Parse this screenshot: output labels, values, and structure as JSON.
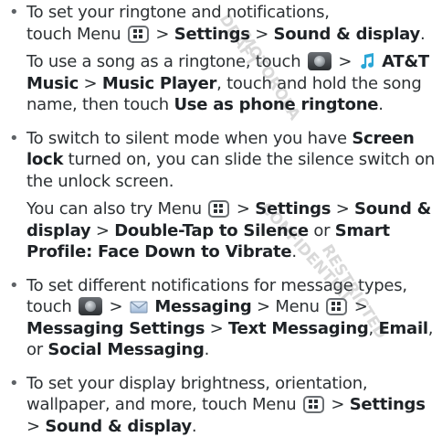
{
  "icons": {
    "menu": "menu-key-icon",
    "launcher": "app-launcher-icon",
    "music": "music-note-icon",
    "messaging": "envelope-icon"
  },
  "colors": {
    "text": "#2d3134",
    "music_note": "#2aa6d6",
    "watermark": "#c6c6c6"
  },
  "watermark": {
    "lines": [
      "DRAFT",
      "MOTOROLA",
      "CONFIDENTIAL",
      "RESTRICTED"
    ]
  },
  "items": [
    {
      "bullet": "•",
      "lines": {
        "p1": "To set your ringtone and notifications,",
        "p2": "touch Menu",
        "sep1": ">",
        "settings": "Settings",
        "sep2": ">",
        "sound_display": "Sound & display",
        "end": "."
      },
      "sub": {
        "p1": "To use a song as a ringtone, touch",
        "sep1": ">",
        "att_music": "AT&T Music",
        "sep2": ">",
        "music_player": "Music Player",
        "p2": ", touch and hold the song name, then touch",
        "use_as": "Use as phone ringtone",
        "end": "."
      }
    },
    {
      "bullet": "•",
      "lines": {
        "p1": "To switch to silent mode when you have",
        "screen_lock": "Screen lock",
        "p2": "turned on, you can slide the silence switch on the unlock screen."
      },
      "sub": {
        "p1": "You can also try Menu",
        "sep1": ">",
        "settings": "Settings",
        "sep2": ">",
        "sound_display": "Sound & display",
        "sep3": ">",
        "double_tap": "Double-Tap to Silence",
        "or": "or",
        "smart_profile": "Smart Profile: Face Down to Vibrate",
        "end": "."
      }
    },
    {
      "bullet": "•",
      "lines": {
        "p1": "To set different notifications for message types, touch",
        "sep1": ">",
        "messaging": "Messaging",
        "sep2": "> Menu",
        "sep3": ">",
        "messaging_settings": "Messaging Settings",
        "sep4": ">",
        "text_messaging": "Text Messaging",
        "comma": ",",
        "email": "Email",
        "or": ", or",
        "social": "Social Messaging",
        "end": "."
      }
    },
    {
      "bullet": "•",
      "lines": {
        "p1": "To set your display brightness, orientation, wallpaper, and more, touch Menu",
        "sep1": ">",
        "settings": "Settings",
        "sep2": ">",
        "sound_display": "Sound & display",
        "end": "."
      }
    }
  ]
}
